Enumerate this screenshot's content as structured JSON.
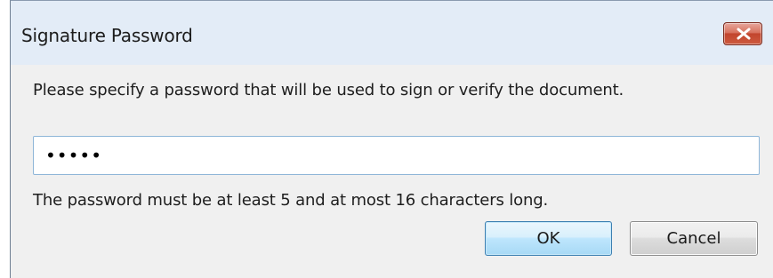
{
  "window": {
    "title": "Signature Password",
    "close_icon": "close-icon"
  },
  "dialog": {
    "message": "Please specify a password that will be used to sign or verify the document.",
    "password_value": "•••••",
    "hint": "The password must be at least 5 and at most 16 characters long."
  },
  "buttons": {
    "ok_label": "OK",
    "cancel_label": "Cancel"
  },
  "colors": {
    "titlebar": "#e3ecf7",
    "content_bg": "#f0f0f0",
    "close_button": "#c2452d",
    "ok_border": "#3c7fb1"
  }
}
